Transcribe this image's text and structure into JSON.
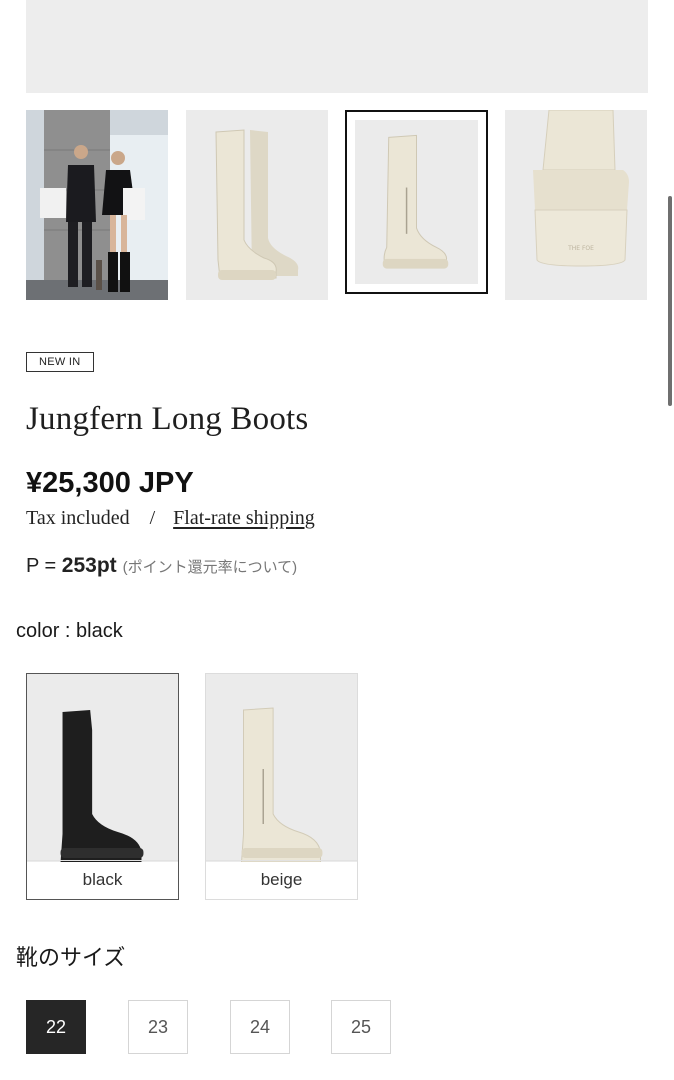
{
  "gallery": {
    "thumbnails": [
      {
        "icon": "models-photo",
        "selected": false
      },
      {
        "icon": "boot-side-beige",
        "selected": false
      },
      {
        "icon": "boot-front-beige",
        "selected": true
      },
      {
        "icon": "boot-sole-detail",
        "selected": false
      }
    ]
  },
  "product": {
    "badge": "NEW IN",
    "name": "Jungfern Long Boots",
    "price": "¥25,300 JPY",
    "tax_text": "Tax included",
    "separator": "/",
    "shipping_link": "Flat-rate shipping",
    "points_prefix": "P = ",
    "points_value": "253pt",
    "points_note": "(ポイント還元率について)"
  },
  "color": {
    "label": "color : black",
    "selected": "black",
    "options": [
      {
        "label": "black",
        "hex": "#1e1e1e"
      },
      {
        "label": "beige",
        "hex": "#ebe6d6"
      }
    ]
  },
  "size": {
    "label": "靴のサイズ",
    "selected": "22",
    "options": [
      "22",
      "23",
      "24",
      "25"
    ]
  },
  "colors": {
    "accent": "#262626",
    "placeholder_bg": "#ebebeb",
    "boot_beige": "#ebe6d6",
    "boot_black": "#1e1e1e"
  }
}
